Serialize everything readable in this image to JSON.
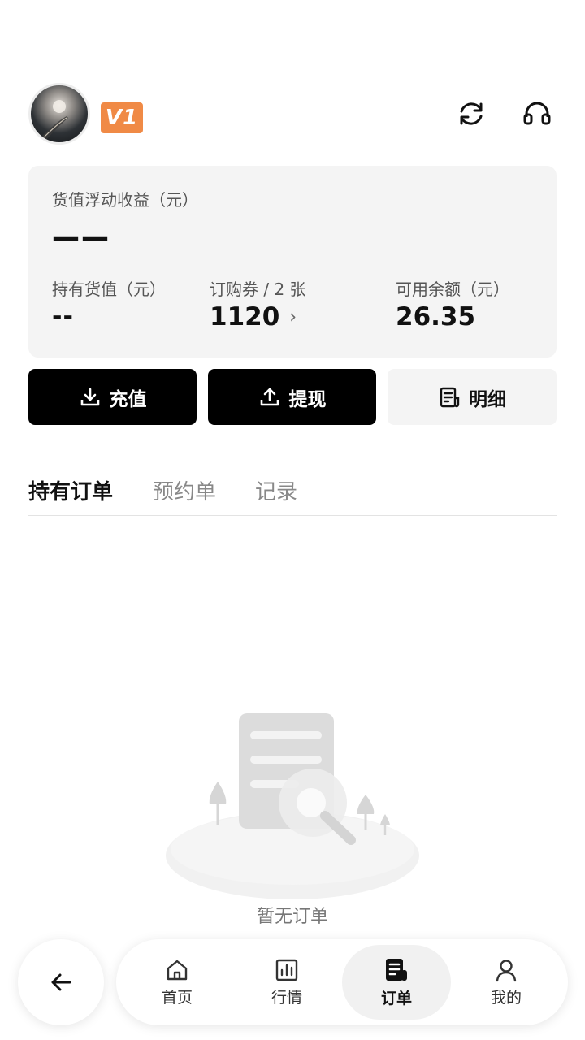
{
  "header": {
    "level_badge": "V1",
    "icons": {
      "refresh": "refresh-icon",
      "support": "headset-icon"
    }
  },
  "summary": {
    "floating_income_label": "货值浮动收益（元）",
    "floating_income_value": "——",
    "holding_value_label": "持有货值（元）",
    "holding_value_value": "--",
    "coupon_label": "订购券 / 2 张",
    "coupon_value": "1120",
    "balance_label": "可用余额（元）",
    "balance_value": "26.35"
  },
  "actions": {
    "recharge_label": "充值",
    "withdraw_label": "提现",
    "detail_label": "明细"
  },
  "tabs": [
    {
      "label": "持有订单",
      "active": true
    },
    {
      "label": "预约单",
      "active": false
    },
    {
      "label": "记录",
      "active": false
    }
  ],
  "empty_state": {
    "text": "暂无订单"
  },
  "bottom_nav": {
    "items": [
      {
        "label": "首页",
        "icon": "home-icon",
        "active": false
      },
      {
        "label": "行情",
        "icon": "chart-icon",
        "active": false
      },
      {
        "label": "订单",
        "icon": "order-icon",
        "active": true
      },
      {
        "label": "我的",
        "icon": "user-icon",
        "active": false
      }
    ]
  },
  "colors": {
    "accent_badge": "#f08a46",
    "primary_button": "#000000",
    "card_bg": "#f4f4f4"
  }
}
